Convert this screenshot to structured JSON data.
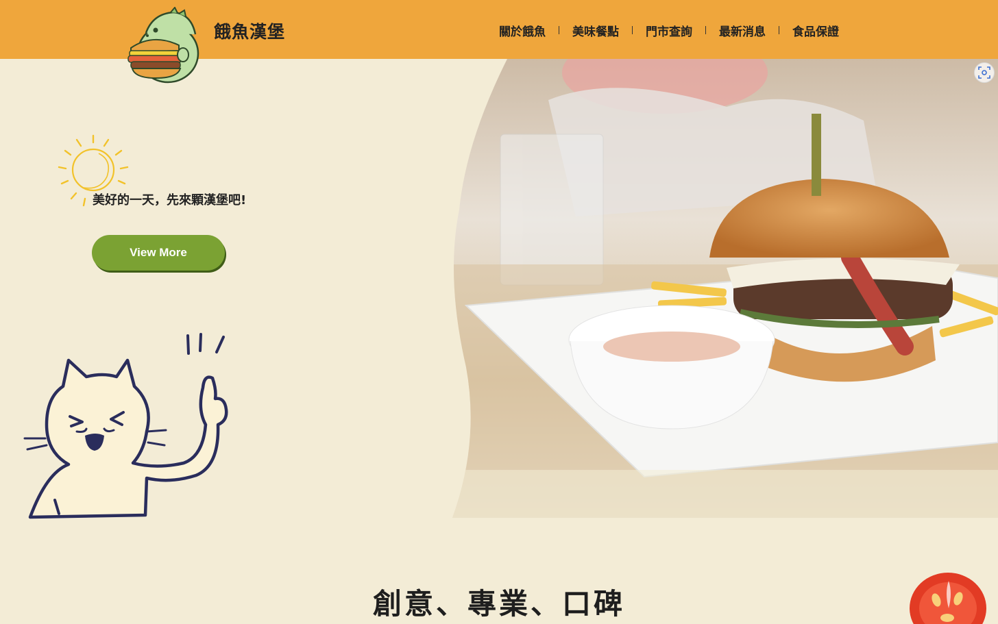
{
  "header": {
    "brand": "餓魚漢堡",
    "nav": [
      {
        "label": "關於餓魚"
      },
      {
        "label": "美味餐點"
      },
      {
        "label": "門市查詢"
      },
      {
        "label": "最新消息"
      },
      {
        "label": "食品保證"
      }
    ]
  },
  "hero": {
    "tagline": "美好的一天，先來顆漢堡吧!",
    "button_label": "View More"
  },
  "section": {
    "title": "創意、專業、口碑"
  },
  "colors": {
    "header_bg": "#efa63c",
    "page_bg": "#f3ecd6",
    "button_bg": "#7ba233",
    "button_shadow": "#3f5d17",
    "sun_yellow": "#f2c22a",
    "cat_outline": "#2a2d5c",
    "cat_fill": "#fbf2d6"
  },
  "icons": {
    "logo": "dino-burger-logo-icon",
    "sun": "sun-icon",
    "scan": "visual-search-icon",
    "cat": "cat-thumbs-up-illustration",
    "tomato": "tomato-slice-icon"
  }
}
